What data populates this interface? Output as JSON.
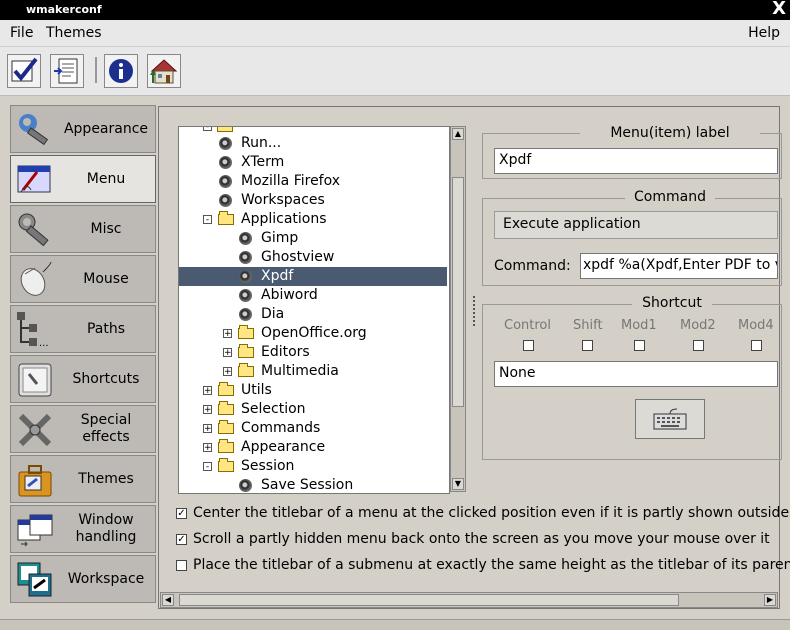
{
  "window": {
    "title": "wmakerconf",
    "close_glyph": "X"
  },
  "menubar": {
    "file": "File",
    "themes": "Themes",
    "help": "Help"
  },
  "toolbar": {
    "icons": [
      "checkmark-icon",
      "document-save-icon",
      "info-icon",
      "house-icon"
    ]
  },
  "sidebar": {
    "items": [
      {
        "label": "Appearance",
        "icon": "wrench-icon"
      },
      {
        "label": "Menu",
        "icon": "menu-editor-icon"
      },
      {
        "label": "Misc",
        "icon": "wrench-icon"
      },
      {
        "label": "Mouse",
        "icon": "mouse-icon"
      },
      {
        "label": "Paths",
        "icon": "paths-icon"
      },
      {
        "label": "Shortcuts",
        "icon": "key-icon"
      },
      {
        "label": "Special\neffects",
        "icon": "special-effects-icon"
      },
      {
        "label": "Themes",
        "icon": "briefcase-icon"
      },
      {
        "label": "Window\nhandling",
        "icon": "window-icon"
      },
      {
        "label": "Workspace",
        "icon": "workspace-icon"
      }
    ],
    "active_index": 1
  },
  "tree": {
    "rows": [
      {
        "label": "Run...",
        "type": "item",
        "depth": 1
      },
      {
        "label": "XTerm",
        "type": "item",
        "depth": 1
      },
      {
        "label": "Mozilla Firefox",
        "type": "item",
        "depth": 1
      },
      {
        "label": "Workspaces",
        "type": "item",
        "depth": 1
      },
      {
        "label": "Applications",
        "type": "folder",
        "depth": 1,
        "expanded": true
      },
      {
        "label": "Gimp",
        "type": "item",
        "depth": 2
      },
      {
        "label": "Ghostview",
        "type": "item",
        "depth": 2
      },
      {
        "label": "Xpdf",
        "type": "item",
        "depth": 2,
        "selected": true
      },
      {
        "label": "Abiword",
        "type": "item",
        "depth": 2
      },
      {
        "label": "Dia",
        "type": "item",
        "depth": 2
      },
      {
        "label": "OpenOffice.org",
        "type": "folder",
        "depth": 2,
        "expanded": false
      },
      {
        "label": "Editors",
        "type": "folder",
        "depth": 2,
        "expanded": false
      },
      {
        "label": "Multimedia",
        "type": "folder",
        "depth": 2,
        "expanded": false
      },
      {
        "label": "Utils",
        "type": "folder",
        "depth": 1,
        "expanded": false
      },
      {
        "label": "Selection",
        "type": "folder",
        "depth": 1,
        "expanded": false
      },
      {
        "label": "Commands",
        "type": "folder",
        "depth": 1,
        "expanded": false
      },
      {
        "label": "Appearance",
        "type": "folder",
        "depth": 1,
        "expanded": false
      },
      {
        "label": "Session",
        "type": "folder",
        "depth": 1,
        "expanded": true
      },
      {
        "label": "Save Session",
        "type": "item",
        "depth": 2
      }
    ]
  },
  "label_group": {
    "title": "Menu(item) label",
    "value": "Xpdf"
  },
  "command_group": {
    "title": "Command",
    "type_value": "Execute application",
    "field_label": "Command:",
    "field_value": "xpdf %a(Xpdf,Enter PDF to v"
  },
  "shortcut_group": {
    "title": "Shortcut",
    "modifiers": [
      "Control",
      "Shift",
      "Mod1",
      "Mod2",
      "Mod4"
    ],
    "value": "None",
    "keyboard_icon": "keyboard-icon"
  },
  "options": [
    {
      "label": "Center the titlebar of a menu at the clicked position even if it is partly shown outside o",
      "checked": true
    },
    {
      "label": "Scroll a partly hidden menu back onto the screen as you move your mouse over it",
      "checked": true
    },
    {
      "label": "Place the titlebar of a submenu at exactly the same height as the titlebar of its parent",
      "checked": false
    }
  ]
}
